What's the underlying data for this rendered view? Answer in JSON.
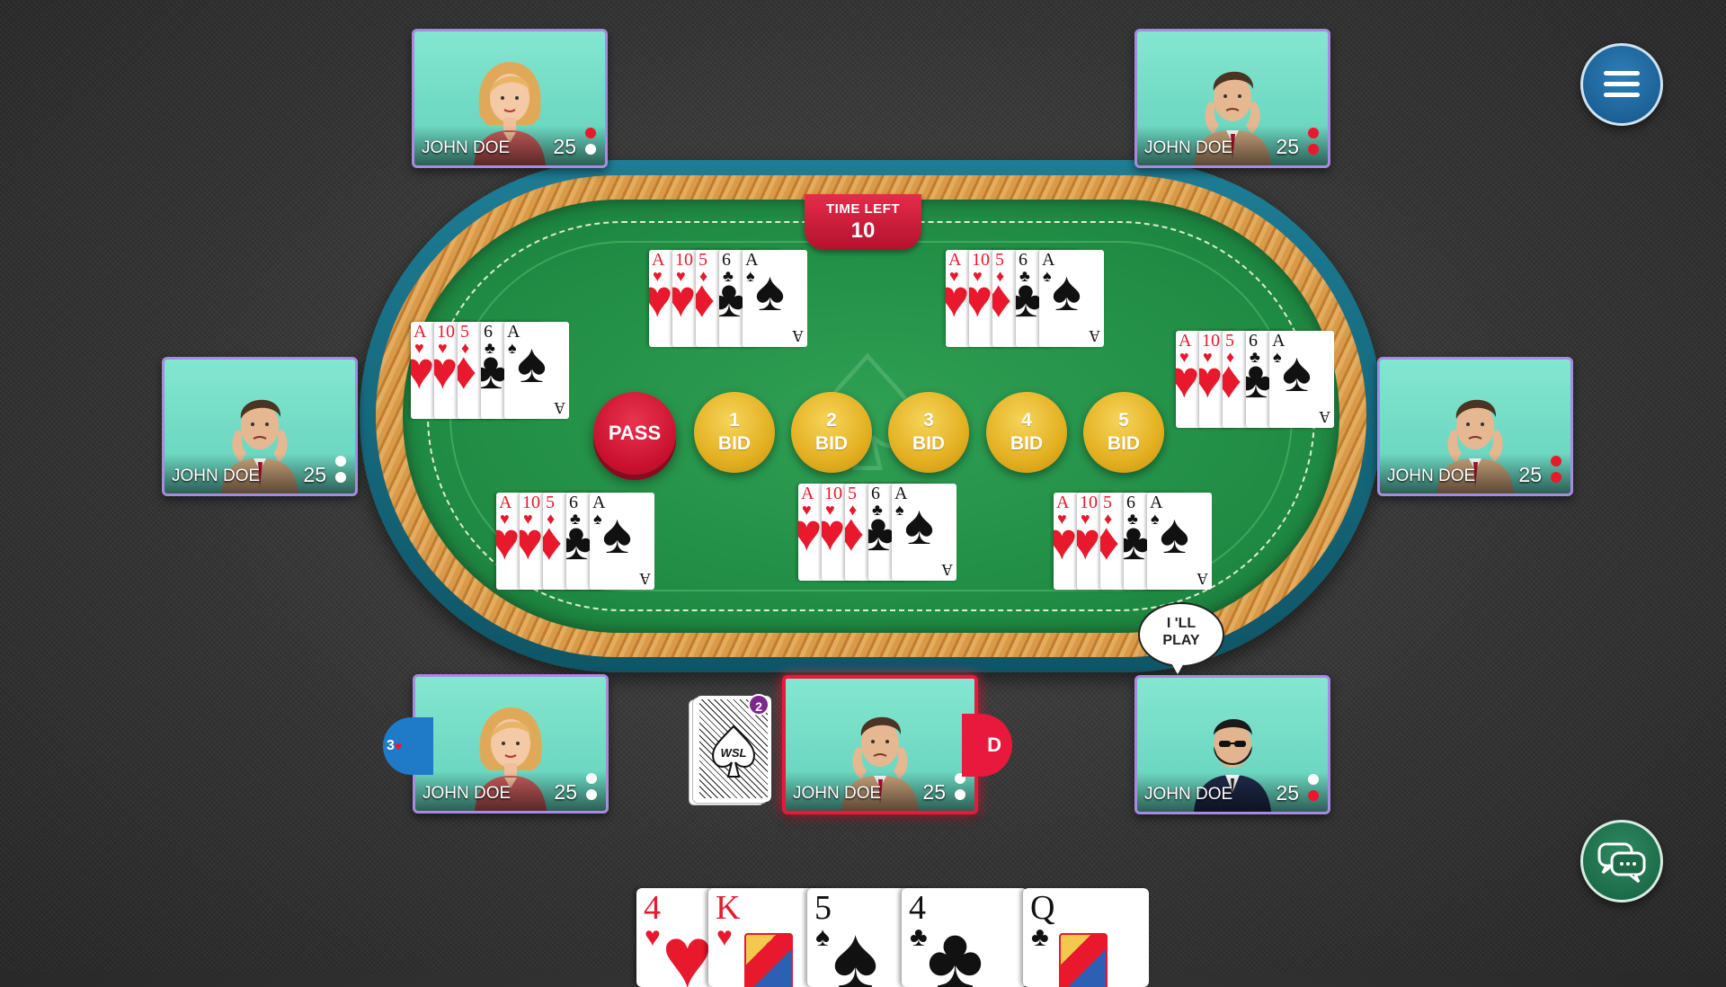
{
  "timer": {
    "label": "TIME LEFT",
    "value": "10"
  },
  "bid_options": {
    "pass_label": "PASS",
    "bids": [
      {
        "number": "1",
        "label": "BID"
      },
      {
        "number": "2",
        "label": "BID"
      },
      {
        "number": "3",
        "label": "BID"
      },
      {
        "number": "4",
        "label": "BID"
      },
      {
        "number": "5",
        "label": "BID"
      }
    ]
  },
  "played_card_fan": {
    "cards": [
      {
        "rank": "A",
        "suit": "♥",
        "color": "red"
      },
      {
        "rank": "10",
        "suit": "♥",
        "color": "red"
      },
      {
        "rank": "5",
        "suit": "♦",
        "color": "red"
      },
      {
        "rank": "6",
        "suit": "♣",
        "color": "black"
      },
      {
        "rank": "A",
        "suit": "♠",
        "color": "black"
      }
    ]
  },
  "players": [
    {
      "name": "JOHN DOE",
      "score": "25",
      "avatar": "woman-avatar",
      "dots": [
        "red",
        "white"
      ]
    },
    {
      "name": "JOHN DOE",
      "score": "25",
      "avatar": "man-worried-avatar",
      "dots": [
        "red",
        "red"
      ]
    },
    {
      "name": "JOHN DOE",
      "score": "25",
      "avatar": "man-worried-avatar",
      "dots": [
        "white",
        "white"
      ]
    },
    {
      "name": "JOHN DOE",
      "score": "25",
      "avatar": "man-worried-avatar",
      "dots": [
        "red",
        "red"
      ]
    },
    {
      "name": "JOHN DOE",
      "score": "25",
      "avatar": "woman-avatar",
      "dots": [
        "white",
        "white"
      ]
    },
    {
      "name": "JOHN DOE",
      "score": "25",
      "avatar": "man-worried-avatar",
      "dots": [
        "white",
        "white"
      ],
      "active": true
    },
    {
      "name": "JOHN DOE",
      "score": "25",
      "avatar": "bearded-man-avatar",
      "dots": [
        "white",
        "red"
      ]
    }
  ],
  "speech_bubble": {
    "line1": "I 'LL",
    "line2": "PLAY"
  },
  "dealer_badge": "D",
  "tricks_badge": {
    "count": "3",
    "suit": "♥"
  },
  "deck": {
    "count": "2",
    "brand": "WSL"
  },
  "hand": [
    {
      "rank": "4",
      "suit": "♥",
      "color": "red",
      "face": false
    },
    {
      "rank": "K",
      "suit": "♥",
      "color": "red",
      "face": true
    },
    {
      "rank": "5",
      "suit": "♠",
      "color": "black",
      "face": false
    },
    {
      "rank": "4",
      "suit": "♣",
      "color": "black",
      "face": false
    },
    {
      "rank": "Q",
      "suit": "♣",
      "color": "black",
      "face": true
    }
  ],
  "colors": {
    "felt": "#1f8a43",
    "rim": "#1d7d95",
    "pass": "#c8102e",
    "bid_gold": "#e3b021",
    "panel": "#6fdac4",
    "panel_border": "#a78be0",
    "active_border": "#e8193c"
  },
  "icons": {
    "menu": "hamburger-icon",
    "chat": "chat-bubbles-icon"
  }
}
